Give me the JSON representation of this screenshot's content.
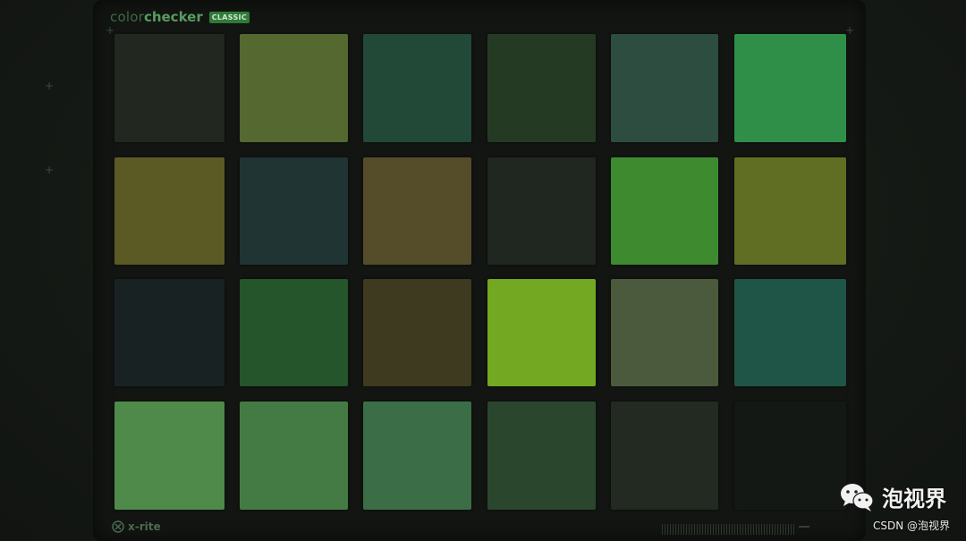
{
  "brand": {
    "light": "color",
    "bold": "checker",
    "badge": "CLASSIC"
  },
  "footer": {
    "logo_text": "x-rite"
  },
  "watermark": {
    "name": "泡视界",
    "icon": "wechat-icon",
    "csdn": "CSDN @泡视界"
  },
  "patch_colors": [
    [
      "#222820",
      "#55682f",
      "#224837",
      "#253a22",
      "#2c4d40",
      "#2f8f48"
    ],
    [
      "#5b5a25",
      "#1f3433",
      "#554c2a",
      "#202620",
      "#3e8a2f",
      "#5f6e23"
    ],
    [
      "#192223",
      "#24552b",
      "#3d3a20",
      "#72a822",
      "#4b5a3c",
      "#1f5546"
    ],
    [
      "#4f8a4a",
      "#447a43",
      "#3b6e47",
      "#2a472e",
      "#222a22",
      "#141814"
    ]
  ]
}
